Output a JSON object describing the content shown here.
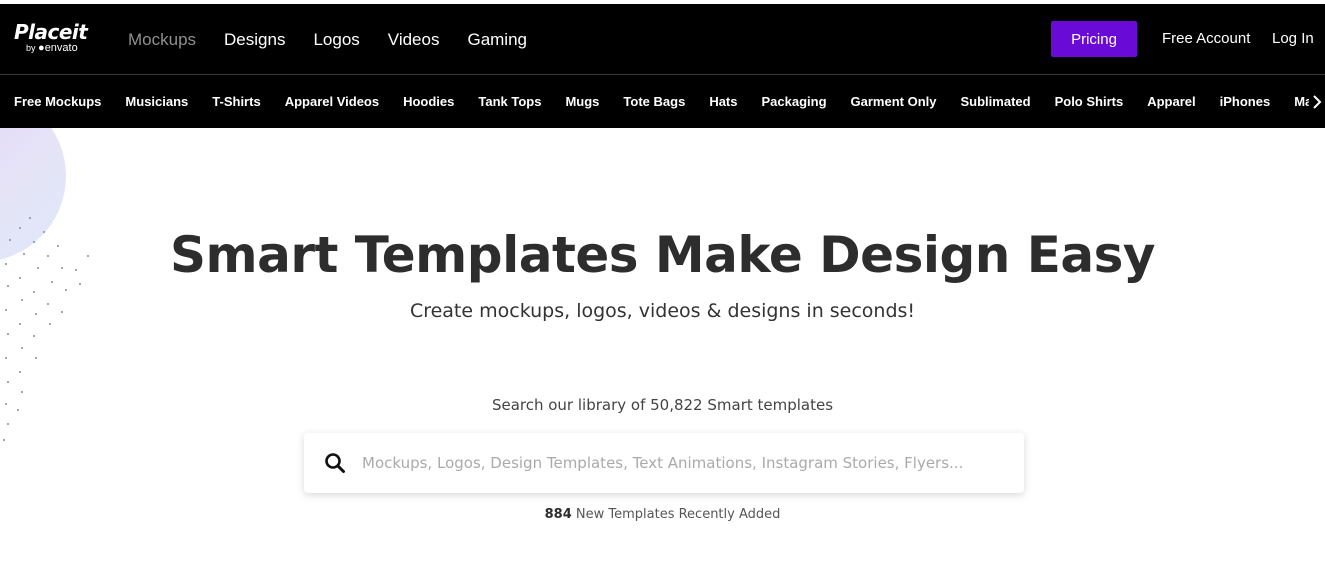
{
  "header": {
    "logo": {
      "main": "Placeit",
      "by": "by",
      "brand": "envato"
    },
    "nav": [
      {
        "label": "Mockups",
        "active": true
      },
      {
        "label": "Designs"
      },
      {
        "label": "Logos"
      },
      {
        "label": "Videos"
      },
      {
        "label": "Gaming"
      }
    ],
    "pricing_label": "Pricing",
    "free_account_label": "Free Account",
    "login_label": "Log In"
  },
  "categories": [
    "Free Mockups",
    "Musicians",
    "T-Shirts",
    "Apparel Videos",
    "Hoodies",
    "Tank Tops",
    "Mugs",
    "Tote Bags",
    "Hats",
    "Packaging",
    "Garment Only",
    "Sublimated",
    "Polo Shirts",
    "Apparel",
    "iPhones",
    "MacBooks"
  ],
  "hero": {
    "title": "Smart Templates Make Design Easy",
    "subtitle": "Create mockups, logos, videos & designs in seconds!",
    "search_caption": "Search our library of 50,822 Smart templates",
    "search_placeholder": "Mockups, Logos, Design Templates, Text Animations, Instagram Stories, Flyers...",
    "new_count": "884",
    "new_label": "New Templates Recently Added"
  },
  "icons": {
    "search": "search-icon",
    "next": "chevron-right-icon"
  },
  "colors": {
    "accent": "#6a0ad6",
    "header_bg": "#000000",
    "title": "#2d2d2d"
  }
}
